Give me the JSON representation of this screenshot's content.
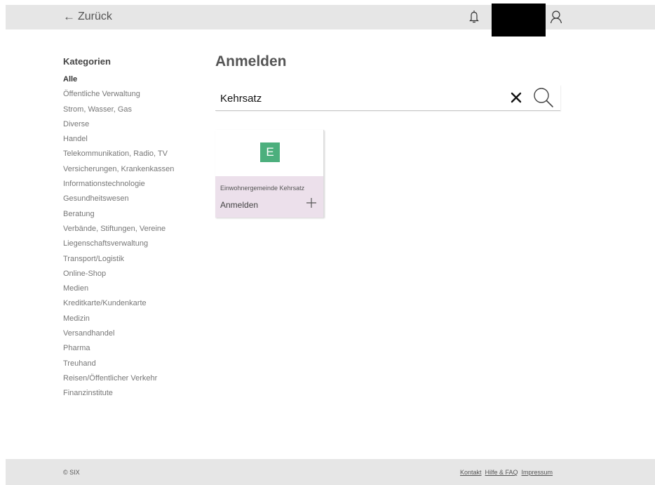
{
  "header": {
    "back_label": "Zurück",
    "icons": [
      "back-arrow-icon",
      "bell-icon",
      "user-icon"
    ]
  },
  "sidebar": {
    "title": "Kategorien",
    "items": [
      {
        "label": "Alle",
        "active": true
      },
      {
        "label": "Öffentliche Verwaltung"
      },
      {
        "label": "Strom, Wasser, Gas"
      },
      {
        "label": "Diverse"
      },
      {
        "label": "Handel"
      },
      {
        "label": "Telekommunikation, Radio, TV"
      },
      {
        "label": "Versicherungen, Krankenkassen"
      },
      {
        "label": "Informationstechnologie"
      },
      {
        "label": "Gesundheitswesen"
      },
      {
        "label": "Beratung"
      },
      {
        "label": "Verbände, Stiftungen, Vereine"
      },
      {
        "label": "Liegenschaftsverwaltung"
      },
      {
        "label": "Transport/Logistik"
      },
      {
        "label": "Online-Shop"
      },
      {
        "label": "Medien"
      },
      {
        "label": "Kreditkarte/Kundenkarte"
      },
      {
        "label": "Medizin"
      },
      {
        "label": "Versandhandel"
      },
      {
        "label": "Pharma"
      },
      {
        "label": "Treuhand"
      },
      {
        "label": "Reisen/Öffentlicher Verkehr"
      },
      {
        "label": "Finanzinstitute"
      }
    ]
  },
  "main": {
    "title": "Anmelden",
    "search": {
      "value": "Kehrsatz",
      "icons": [
        "clear-icon",
        "search-icon"
      ]
    },
    "results": [
      {
        "logo_letter": "E",
        "logo_color": "#4caf7d",
        "name": "Einwohnergemeinde Kehrsatz",
        "action_label": "Anmelden",
        "action_icon": "plus-icon"
      }
    ]
  },
  "footer": {
    "copyright": "© SIX",
    "links": [
      "Kontakt",
      "Hilfe & FAQ",
      "Impressum"
    ]
  },
  "colors": {
    "header_bg": "#e6e6e6",
    "card_bottom_bg": "#ece0eb",
    "logo_green": "#4caf7d"
  }
}
